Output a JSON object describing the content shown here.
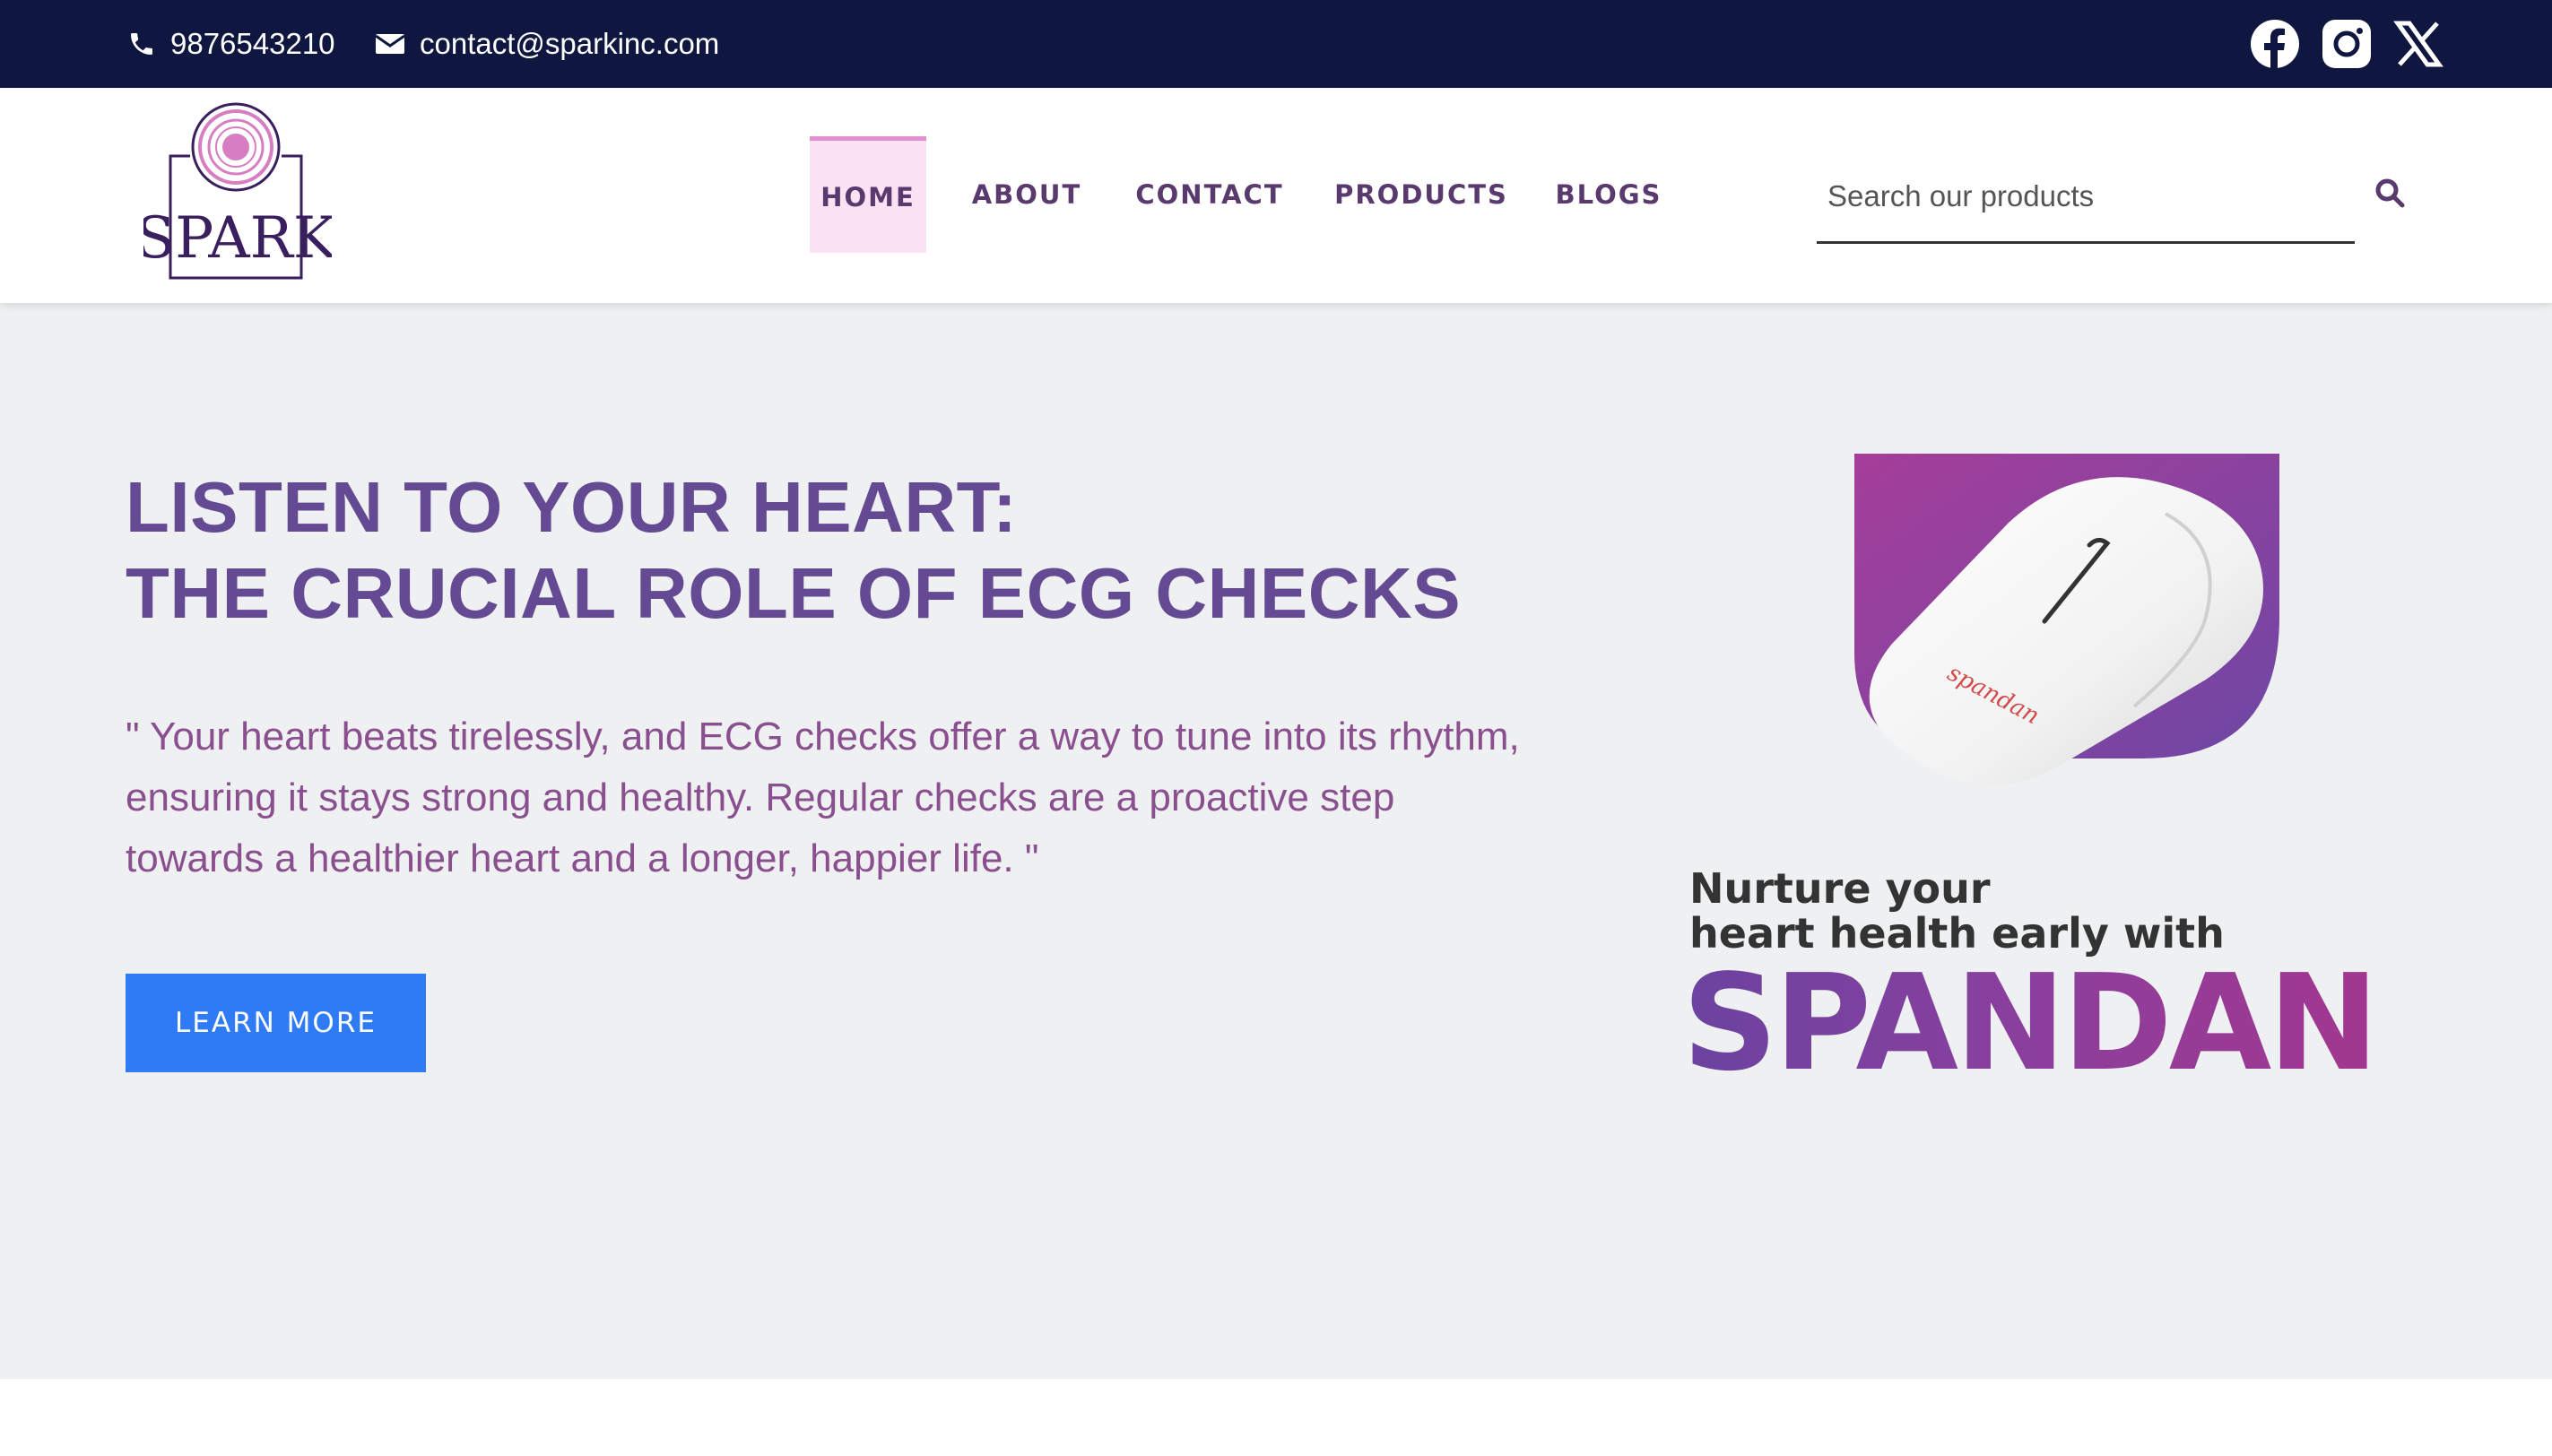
{
  "topbar": {
    "phone": "9876543210",
    "email": "contact@sparkinc.com",
    "social": [
      "facebook-icon",
      "instagram-icon",
      "x-icon"
    ]
  },
  "header": {
    "logo_text": "SPARK",
    "nav": [
      {
        "label": "HOME",
        "active": true
      },
      {
        "label": "ABOUT",
        "active": false
      },
      {
        "label": "CONTACT",
        "active": false
      },
      {
        "label": "PRODUCTS",
        "active": false
      },
      {
        "label": "BLOGS",
        "active": false
      }
    ],
    "search": {
      "placeholder": "Search our products",
      "value": ""
    }
  },
  "hero": {
    "title_line1": "LISTEN TO YOUR HEART:",
    "title_line2": "THE CRUCIAL ROLE OF ECG CHECKS",
    "quote": "\" Your heart beats tirelessly, and ECG checks offer a way to tune into its rhythm, ensuring it stays strong and healthy. Regular checks are a proactive step towards a healthier heart and a longer, happier life. \"",
    "button_label": "LEARN MORE",
    "promo": {
      "line1": "Nurture your",
      "line2": "heart health early with",
      "brand": "SPANDAN",
      "device_label": "spandan"
    }
  },
  "colors": {
    "topbar": "#0f1740",
    "title": "#644a93",
    "quote": "#8a4f8e",
    "button": "#2f7af5",
    "nav_active_bg": "#fbe3f3"
  }
}
